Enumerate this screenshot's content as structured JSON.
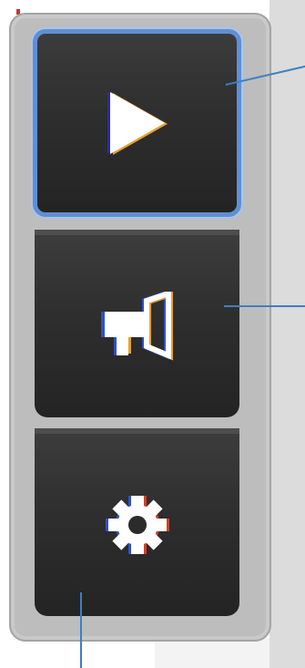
{
  "toolbar": {
    "buttons": [
      {
        "name": "play",
        "icon": "play-icon",
        "selected": true
      },
      {
        "name": "announce",
        "icon": "megaphone-icon",
        "selected": false
      },
      {
        "name": "settings",
        "icon": "gear-icon",
        "selected": false
      }
    ]
  },
  "colors": {
    "selection_border": "#5f8fd4",
    "callout_line": "#3f7fc0",
    "button_dark": "#2b2b2b",
    "frame_gray": "#bdbdbd"
  }
}
